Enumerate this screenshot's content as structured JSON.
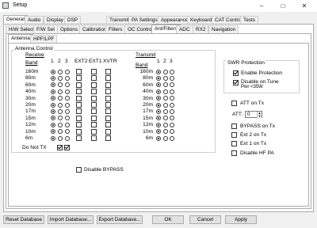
{
  "window": {
    "title": "Setup",
    "minimize": "–",
    "maximize": "□",
    "close": "✕"
  },
  "main_tabs": [
    "General",
    "Audio",
    "Display",
    "DSP",
    "Transmit",
    "PA Settings",
    "Appearance",
    "Keyboard",
    "CAT Control",
    "Tests"
  ],
  "sub_tabs": [
    "H/W Select",
    "F/W Set",
    "Options",
    "Calibration",
    "Filters",
    "OC Control",
    "Ant/Filters",
    "ADC",
    "RX2",
    "Navigation"
  ],
  "inner_tabs": [
    "Antenna",
    "HPF/LPF"
  ],
  "antenna": {
    "group_title": "Antenna Control",
    "receive_label": "Receive",
    "transmit_label": "Transmit",
    "band_label": "Band",
    "port_headers": [
      "1",
      "2",
      "3"
    ],
    "rx_only_headers": [
      "EXT2",
      "EXT1",
      "XVTR"
    ],
    "bands": [
      "160m",
      "80m",
      "60m",
      "40m",
      "30m",
      "20m",
      "17m",
      "15m",
      "12m",
      "10m",
      "6m"
    ],
    "do_not_tx_label": "Do Not TX",
    "disable_bypass_label": "Disable BYPASS"
  },
  "swr": {
    "group_title": "SWR Protection",
    "enable_label": "Enable Protection",
    "enable_checked": true,
    "disable_on_tune_label": "Disable on Tune",
    "disable_on_tune_sub": "Pwr <35W",
    "disable_on_tune_checked": true
  },
  "options": {
    "att_on_tx": "ATT on Tx",
    "att_label": "ATT:",
    "att_value": "0",
    "bypass_on_tx": "BYPASS on Tx",
    "ext2_on_tx": "Ext 2 on Tx",
    "ext1_on_tx": "Ext 1 on Tx",
    "disable_hf_pa": "Disable HF PA"
  },
  "footer": {
    "reset": "Reset Database",
    "import": "Import Database...",
    "export": "Export Database...",
    "ok": "OK",
    "cancel": "Cancel",
    "apply": "Apply"
  }
}
